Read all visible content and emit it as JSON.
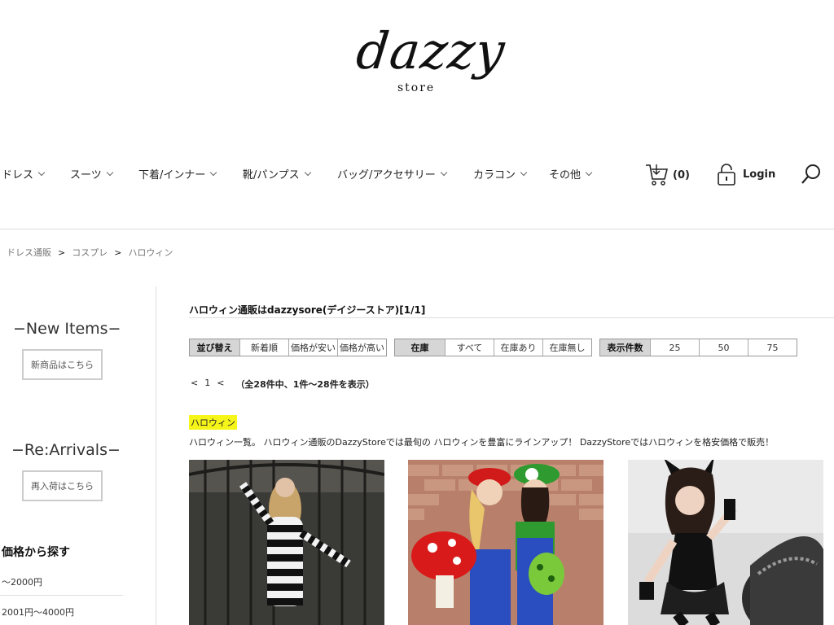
{
  "logo": {
    "text": "dazzy",
    "sub": "store"
  },
  "nav": {
    "items": [
      {
        "label": "ドレス"
      },
      {
        "label": "スーツ"
      },
      {
        "label": "下着/インナー"
      },
      {
        "label": "靴/パンプス"
      },
      {
        "label": "バッグ/アクセサリー"
      },
      {
        "label": "カラコン"
      },
      {
        "label": "その他"
      }
    ],
    "cart_count": "(0)",
    "login_label": "Login"
  },
  "breadcrumb": {
    "items": [
      "ドレス通販",
      "コスプレ",
      "ハロウィン"
    ],
    "separator": ">"
  },
  "sidebar": {
    "new_items": {
      "heading": "−New Items−",
      "button": "新商品はこちら"
    },
    "rearrivals": {
      "heading": "−Re:Arrivals−",
      "button": "再入荷はこちら"
    },
    "price": {
      "title": "価格から探す",
      "ranges": [
        "〜2000円",
        "2001円〜4000円"
      ]
    }
  },
  "main": {
    "title": "ハロウィン通販はdazzysore(デイジーストア)[1/1]",
    "sort": {
      "label": "並び替え",
      "options": [
        "新着順",
        "価格が安い",
        "価格が高い"
      ]
    },
    "stock": {
      "label": "在庫",
      "options": [
        "すべて",
        "在庫あり",
        "在庫無し"
      ]
    },
    "per_page": {
      "label": "表示件数",
      "options": [
        "25",
        "50",
        "75"
      ]
    },
    "pager": {
      "prev": "<",
      "page": "1",
      "next": "<",
      "summary": "（全28件中、1件〜28件を表示）"
    },
    "category_tag": "ハロウィン",
    "description": "ハロウィン一覧。 ハロウィン通販のDazzyStoreでは最旬の ハロウィンを豊富にラインアップ！ DazzyStoreではハロウィンを格安価格で販売！"
  },
  "colors": {
    "highlight": "#f5f51a",
    "divider": "#dddddd",
    "control_header": "#d6d6d6"
  }
}
